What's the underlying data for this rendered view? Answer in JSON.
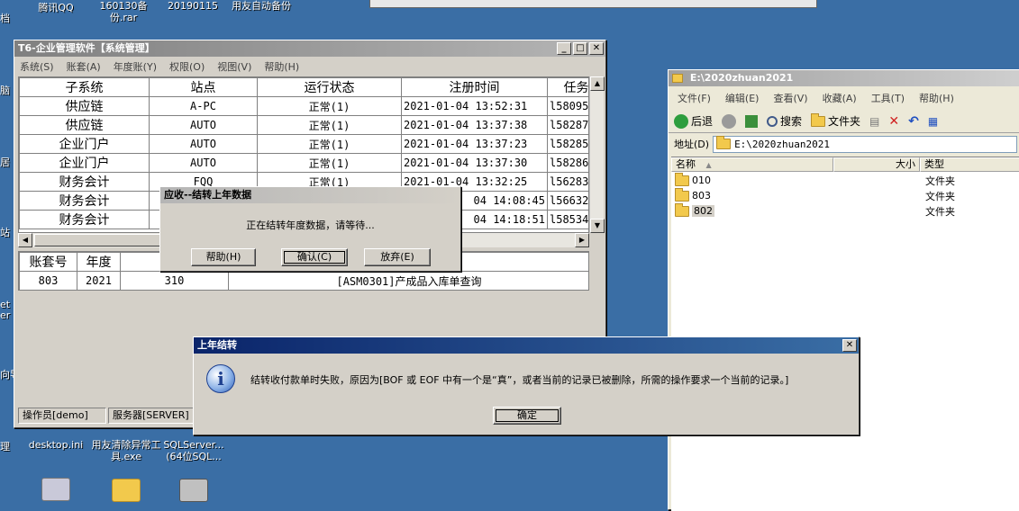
{
  "desktop": {
    "icons": [
      {
        "label": "腾讯QQ",
        "color": "#2f6fd1"
      },
      {
        "label": "160130备份.rar",
        "color": "#8e3fa9"
      },
      {
        "label": "20190115",
        "color": "#f2c94c"
      },
      {
        "label": "用友自动备份",
        "color": "#f2c94c"
      },
      {
        "label": "desktop.ini",
        "color": "#e0e0e0"
      },
      {
        "label": "用友清除异常工具.exe",
        "color": "#6a9ad6"
      },
      {
        "label": "SQLServer...(64位SQL...",
        "color": "#c0c0c0"
      }
    ],
    "edge_labels": [
      "档",
      "脑",
      "居",
      "站",
      "et",
      "er",
      "向导",
      "理"
    ]
  },
  "main_window": {
    "title": "T6-企业管理软件【系统管理】",
    "menu": [
      "系统(S)",
      "账套(A)",
      "年度账(Y)",
      "权限(O)",
      "视图(V)",
      "帮助(H)"
    ],
    "grid": {
      "columns": [
        "子系统",
        "站点",
        "运行状态",
        "注册时间",
        "任务"
      ],
      "rows": [
        [
          "供应链",
          "A-PC",
          "正常(1)",
          "2021-01-04 13:52:31",
          "l58095"
        ],
        [
          "供应链",
          "AUTO",
          "正常(1)",
          "2021-01-04 13:37:38",
          "l58287"
        ],
        [
          "企业门户",
          "AUTO",
          "正常(1)",
          "2021-01-04 13:37:23",
          "l58285"
        ],
        [
          "企业门户",
          "AUTO",
          "正常(1)",
          "2021-01-04 13:37:30",
          "l58286"
        ],
        [
          "财务会计",
          "FQQ",
          "正常(1)",
          "2021-01-04 13:32:25",
          "l56283"
        ],
        [
          "财务会计",
          "",
          "",
          "04 14:08:45",
          "l56632"
        ],
        [
          "财务会计",
          "",
          "",
          "04 14:18:51",
          "l58534"
        ]
      ]
    },
    "grid2": {
      "columns": [
        "账套号",
        "年度",
        "提"
      ],
      "rows": [
        [
          "803",
          "2021",
          "310",
          "[ASM0301]产成品入库单查询"
        ]
      ]
    },
    "status": [
      "操作员[demo]",
      "服务器[SERVER]"
    ]
  },
  "progress_dialog": {
    "title": "应收--结转上年数据",
    "message": "正在结转年度数据，请等待...",
    "buttons": [
      "帮助(H)",
      "确认(C)",
      "放弃(E)"
    ]
  },
  "error_dialog": {
    "title": "上年结转",
    "message": "结转收付款单时失败，原因为[BOF 或 EOF 中有一个是“真”，或者当前的记录已被删除，所需的操作要求一个当前的记录。]",
    "ok_label": "确定",
    "close_label": "✕"
  },
  "explorer": {
    "title": "E:\\2020zhuan2021",
    "menu": [
      "文件(F)",
      "编辑(E)",
      "查看(V)",
      "收藏(A)",
      "工具(T)",
      "帮助(H)"
    ],
    "toolbar": {
      "back": "后退",
      "search": "搜索",
      "folders": "文件夹"
    },
    "address_label": "地址(D)",
    "address_value": "E:\\2020zhuan2021",
    "headers": {
      "name": "名称",
      "size": "大小",
      "type": "类型"
    },
    "items": [
      {
        "name": "010",
        "type": "文件夹"
      },
      {
        "name": "803",
        "type": "文件夹"
      },
      {
        "name": "802",
        "type": "文件夹"
      }
    ]
  }
}
